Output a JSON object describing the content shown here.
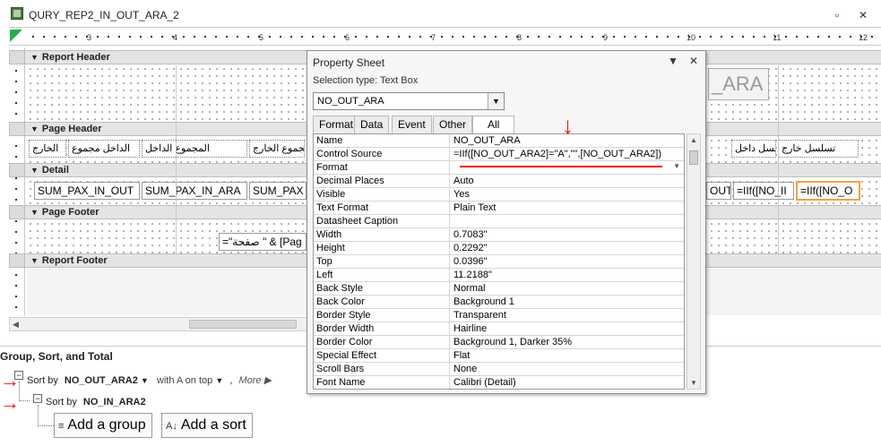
{
  "window": {
    "title": "QURY_REP2_IN_OUT_ARA_2",
    "minimize_glyph": "▫",
    "close_glyph": "✕"
  },
  "ruler": {
    "numbers": [
      "3",
      "4",
      "5",
      "6",
      "7",
      "8",
      "9",
      "10",
      "11",
      "12"
    ]
  },
  "sections": {
    "report_header": "Report Header",
    "page_header": "Page Header",
    "detail": "Detail",
    "page_footer": "Page Footer",
    "report_footer": "Report Footer"
  },
  "page_header_labels": [
    "الخارج",
    "الداخل مجموع",
    "المجموع الداخل",
    "مجموع الخارج",
    "تسلسل داخل",
    "تسلسل خارج"
  ],
  "detail_controls": [
    "SUM_PAX_IN_OUT",
    "SUM_PAX_IN_ARA",
    "SUM_PAX",
    "OUT_",
    "=IIf([NO_II",
    "=IIf([NO_O"
  ],
  "report_header_ghost": "_ARA",
  "page_footer_control": "=\"صفحة \" & [Pag",
  "property_sheet": {
    "title": "Property Sheet",
    "selection_type": "Selection type:  Text Box",
    "object_name": "NO_OUT_ARA",
    "tabs": [
      "Format",
      "Data",
      "Event",
      "Other",
      "All"
    ],
    "active_tab": "All",
    "rows": [
      {
        "name": "Name",
        "value": "NO_OUT_ARA"
      },
      {
        "name": "Control Source",
        "value": "=IIf([NO_OUT_ARA2]=\"A\",\"\",[NO_OUT_ARA2])"
      },
      {
        "name": "Format",
        "value": ""
      },
      {
        "name": "Decimal Places",
        "value": "Auto"
      },
      {
        "name": "Visible",
        "value": "Yes"
      },
      {
        "name": "Text Format",
        "value": "Plain Text"
      },
      {
        "name": "Datasheet Caption",
        "value": ""
      },
      {
        "name": "Width",
        "value": "0.7083\""
      },
      {
        "name": "Height",
        "value": "0.2292\""
      },
      {
        "name": "Top",
        "value": "0.0396\""
      },
      {
        "name": "Left",
        "value": "11.2188\""
      },
      {
        "name": "Back Style",
        "value": "Normal"
      },
      {
        "name": "Back Color",
        "value": "Background 1"
      },
      {
        "name": "Border Style",
        "value": "Transparent"
      },
      {
        "name": "Border Width",
        "value": "Hairline"
      },
      {
        "name": "Border Color",
        "value": "Background 1, Darker 35%"
      },
      {
        "name": "Special Effect",
        "value": "Flat"
      },
      {
        "name": "Scroll Bars",
        "value": "None"
      },
      {
        "name": "Font Name",
        "value": "Calibri (Detail)"
      }
    ]
  },
  "group_sort_total": {
    "title": "Group, Sort, and Total",
    "level1_prefix": "Sort by",
    "level1_field": "NO_OUT_ARA2",
    "level1_order": "with A on top",
    "level1_more": "More ▶",
    "level2_prefix": "Sort by",
    "level2_field": "NO_IN_ARA2",
    "add_group_label": "Add a group",
    "add_sort_label": "Add a sort"
  },
  "colors": {
    "selection_border": "#f4a040",
    "annotation_red": "#e11111",
    "section_band": "#e4e4e4"
  }
}
